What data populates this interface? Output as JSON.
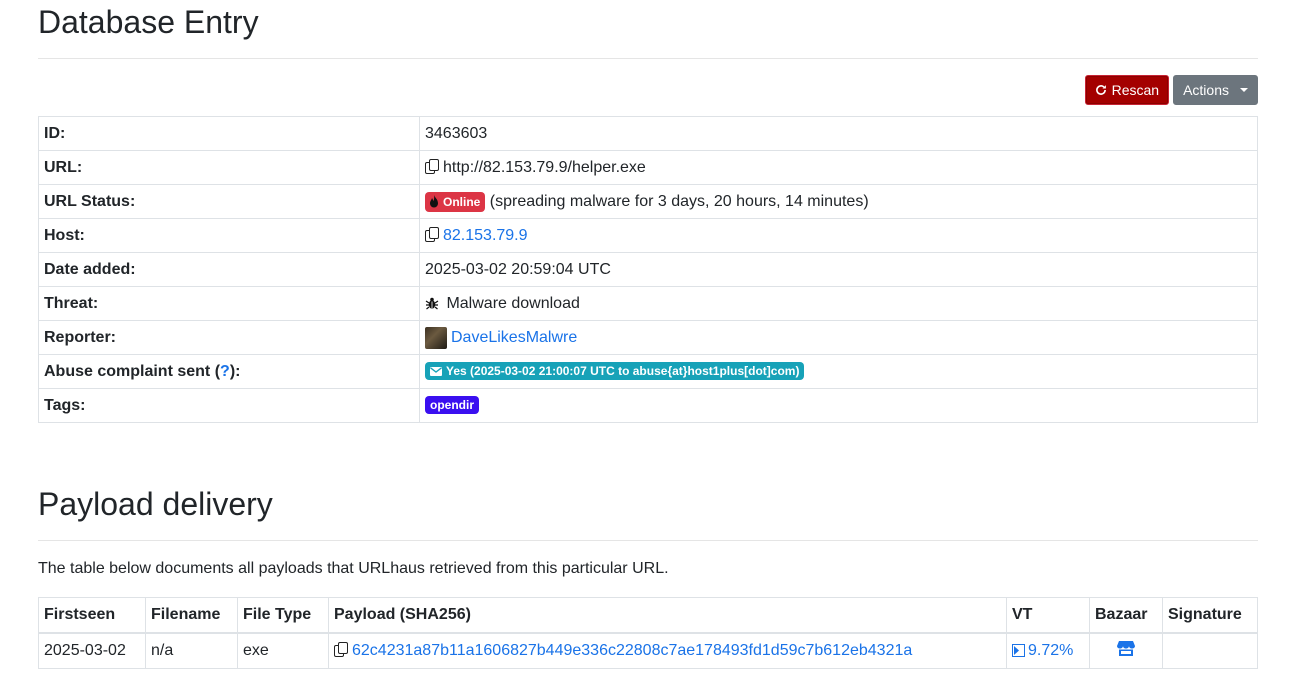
{
  "page": {
    "title": "Database Entry",
    "toolbar": {
      "rescan_label": "Rescan",
      "actions_label": "Actions"
    }
  },
  "entry": {
    "id_label": "ID:",
    "id": "3463603",
    "url_label": "URL:",
    "url": "http://82.153.79.9/helper.exe",
    "status_label": "URL Status:",
    "status_badge": "Online",
    "status_text": "(spreading malware for 3 days, 20 hours, 14 minutes)",
    "host_label": "Host:",
    "host": "82.153.79.9",
    "date_label": "Date added:",
    "date": "2025-03-02 20:59:04 UTC",
    "threat_label": "Threat:",
    "threat": "Malware download",
    "reporter_label": "Reporter:",
    "reporter": "DaveLikesMalwre",
    "abuse_label_prefix": "Abuse complaint sent (",
    "abuse_help": "?",
    "abuse_label_suffix": "):",
    "abuse_value": "Yes (2025-03-02 21:00:07 UTC to abuse{at}host1plus[dot]com)",
    "tags_label": "Tags:",
    "tag": "opendir"
  },
  "payload": {
    "title": "Payload delivery",
    "description": "The table below documents all payloads that URLhaus retrieved from this particular URL.",
    "columns": [
      "Firstseen",
      "Filename",
      "File Type",
      "Payload (SHA256)",
      "VT",
      "Bazaar",
      "Signature"
    ],
    "rows": [
      {
        "firstseen": "2025-03-02",
        "filename": "n/a",
        "filetype": "exe",
        "sha256": "62c4231a87b11a1606827b449e336c22808c7ae178493fd1d59c7b612eb4321a",
        "vt": "9.72%",
        "signature": ""
      }
    ]
  },
  "icons": {
    "rescan": "refresh-icon",
    "copy": "copy-icon",
    "online": "fire-icon",
    "threat": "bug-icon",
    "abuse": "envelope-icon",
    "vt": "virustotal-icon",
    "bazaar": "store-icon"
  },
  "colors": {
    "rescan": "#a40000",
    "actions": "#6c757d",
    "online": "#dc3545",
    "abuse": "#17a2b8",
    "tag": "#3a0ff0",
    "link": "#1a73e8"
  }
}
